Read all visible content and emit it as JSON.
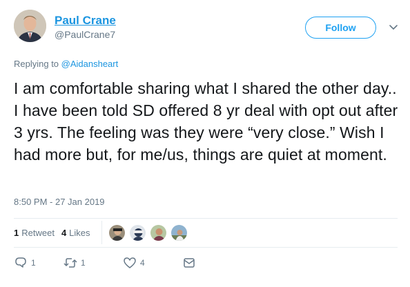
{
  "author": {
    "name": "Paul Crane",
    "handle": "@PaulCrane7"
  },
  "follow_label": "Follow",
  "reply": {
    "prefix": "Replying to ",
    "target": "@Aidansheart"
  },
  "tweet": {
    "text": "I am comfortable sharing what I shared the other day.. I have been told SD offered 8 yr deal with opt out after 3 yrs. The feeling was they were “very close.” Wish I had more but, for me/us, things are quiet at moment."
  },
  "timestamp": "8:50 PM - 27 Jan 2019",
  "stats": {
    "retweets_count": "1",
    "retweets_label": "Retweet",
    "likes_count": "4",
    "likes_label": "Likes"
  },
  "actions": {
    "reply_count": "1",
    "retweet_count": "1",
    "like_count": "4"
  },
  "colors": {
    "accent": "#1da1f2",
    "link": "#1b95e0",
    "muted": "#657786",
    "text": "#14171a"
  },
  "icons": [
    "avatar",
    "chevron-down-icon",
    "reply-icon",
    "retweet-icon",
    "heart-icon",
    "message-icon"
  ]
}
